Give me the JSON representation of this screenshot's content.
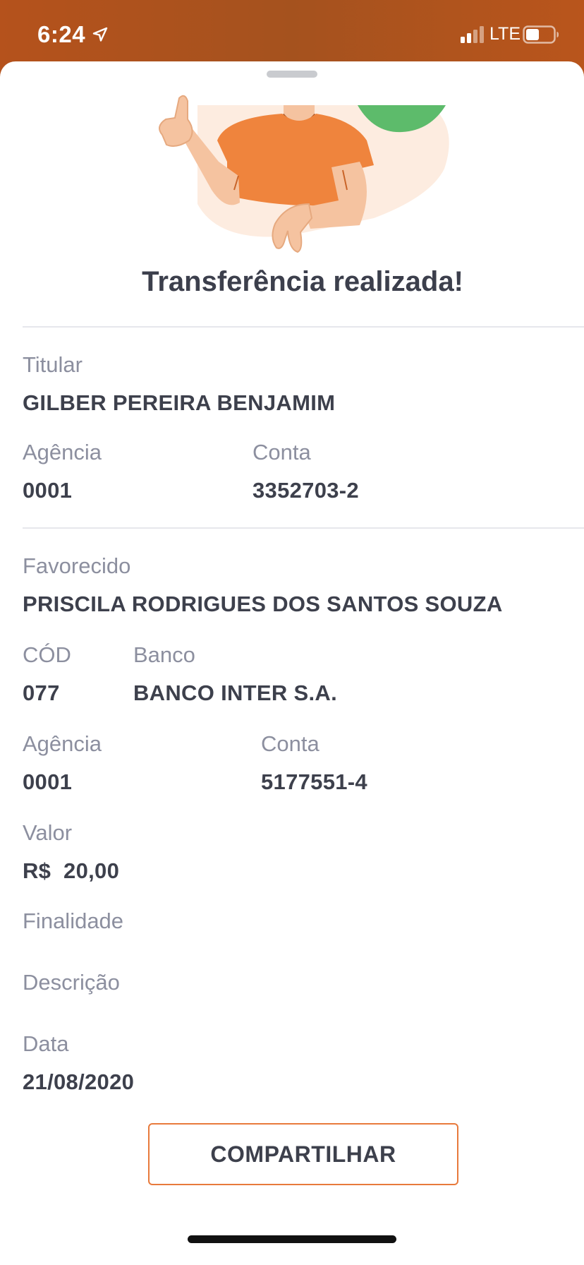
{
  "status_bar": {
    "time": "6:24",
    "network": "LTE",
    "icons": [
      "location-arrow-icon",
      "signal-icon",
      "battery-icon"
    ]
  },
  "sheet": {
    "title": "Transferência realizada!",
    "illustration": "person-thumbs-up-illustration"
  },
  "titular": {
    "label": "Titular",
    "value": "GILBER PEREIRA BENJAMIM",
    "agencia_label": "Agência",
    "agencia_value": "0001",
    "conta_label": "Conta",
    "conta_value": "3352703-2"
  },
  "favorecido": {
    "label": "Favorecido",
    "value": "PRISCILA RODRIGUES DOS SANTOS SOUZA",
    "cod_label": "CÓD",
    "cod_value": "077",
    "banco_label": "Banco",
    "banco_value": "BANCO INTER S.A.",
    "agencia_label": "Agência",
    "agencia_value": "0001",
    "conta_label": "Conta",
    "conta_value": "5177551-4"
  },
  "valor": {
    "label": "Valor",
    "value": "R$  20,00"
  },
  "finalidade": {
    "label": "Finalidade"
  },
  "descricao": {
    "label": "Descrição"
  },
  "data": {
    "label": "Data",
    "value": "21/08/2020"
  },
  "actions": {
    "share_label": "COMPARTILHAR"
  },
  "colors": {
    "brand_orange": "#e87a3c",
    "header_bg": "#a5521e",
    "text_dark": "#3d404c",
    "text_muted": "#8c8f9f",
    "success_green": "#5dbb6b"
  }
}
